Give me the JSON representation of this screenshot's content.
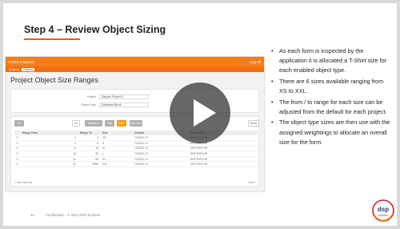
{
  "slide": {
    "title": "Step 4 – Review Object Sizing",
    "footer_page": "34",
    "footer_text": "Confidential – © 2021 DSP-Explorer"
  },
  "app": {
    "header_title": "Forms Inspector",
    "header_right": "Log off",
    "nav": [
      "Projects",
      "Options"
    ],
    "page_title": "Project Object Size Ranges",
    "form": {
      "project_label": "Project",
      "project_value": "Sample Project 9",
      "object_type_label": "Object Type",
      "object_type_value": "Database Block"
    },
    "toolbar": {
      "first": "",
      "b1": "Go",
      "b2": "Actions ▾",
      "b3": "Edit",
      "b4": "Save",
      "b5": "Add Row",
      "reset": "Reset"
    },
    "columns": [
      "",
      "Range From",
      "Range To",
      "Size",
      "Created",
      "Created By"
    ],
    "rows": [
      [
        "",
        "1",
        "3",
        "XS",
        "7/1/2021 17",
        "DSP-EXPLOR"
      ],
      [
        "",
        "4",
        "8",
        "S",
        "7/1/2021 17",
        "DSP-EXPLOR"
      ],
      [
        "",
        "9",
        "15",
        "M",
        "7/1/2021 17",
        "DSP-EXPLOR"
      ],
      [
        "",
        "16",
        "30",
        "L",
        "7/1/2021 17",
        "DSP-EXPLOR"
      ],
      [
        "",
        "31",
        "60",
        "XL",
        "7/1/2021 17",
        "DSP-EXPLOR"
      ],
      [
        "",
        "61",
        "9999",
        "XXL",
        "7/1/2021 17",
        "DSP-EXPLOR"
      ]
    ],
    "footer_left": "1 rows selected",
    "footer_right": "Total 6"
  },
  "bullets": [
    "As each form is inspected by the application it is allocated a T-Shirt size for each enabled object type.",
    "There are 6 sizes available ranging from XS to XXL.",
    "The from / to range for each size can be adjusted from the default for each project.",
    "The object type sizes are then use with the assigned weightings to allocate an overall size for the form."
  ],
  "logo": {
    "text": "dsp",
    "sub": "explorer",
    "color": "#d81e2a"
  },
  "colors": {
    "accent": "#f57f17",
    "title_underline": "#e85d1a"
  },
  "icons": {
    "play": "play-icon"
  }
}
